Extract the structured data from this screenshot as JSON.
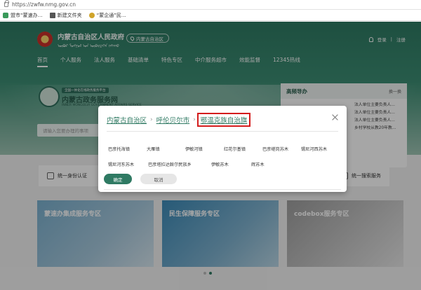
{
  "browser": {
    "url": "https://zwfw.nmg.gov.cn",
    "bookmarks": [
      "盟市“蒙速办…",
      "新建文件夹",
      "“蒙企通”民…"
    ]
  },
  "header": {
    "title": "内蒙古自治区人民政府",
    "subtitle": "ᠦᠪᠦᠷ ᠮᠣᠩᠭᠣᠯ ᠤᠨ ᠥᠪᠡᠷᠲᠡᠭᠡᠨ ᠵᠠᠰᠠᠬᠤ",
    "location": "内蒙古自治区",
    "login": "登录",
    "register": "注册",
    "nav": [
      "首页",
      "个人服务",
      "法人服务",
      "基础清单",
      "特色专区",
      "中介服务超市",
      "效能监督",
      "12345热线"
    ]
  },
  "platform": {
    "tag": "全国一体化在线政务服务平台",
    "name": "内蒙古政务服务网",
    "name_en": "INNER MONGOLIA GOVERNMENT AFFAIRS SERVICE",
    "search_placeholder": "请输入您要办理的事项"
  },
  "guide": {
    "title": "高频导办",
    "next": "换一换",
    "items": [
      "法人单位主要负责人…",
      "法人单位主要负责人…",
      "法人单位主要负责人…",
      "乡村学校从教20年教…"
    ]
  },
  "dialog": {
    "breadcrumb": [
      "内蒙古自治区",
      "呼伦贝尔市",
      "鄂温克族自治旗"
    ],
    "towns": [
      [
        "巴彦托海镇",
        "大雁镇",
        "伊敏河镇",
        "红花尔基镇",
        "巴彦嵯岗苏木",
        "锡尼河西苏木"
      ],
      [
        "锡尼河东苏木",
        "巴彦塔拉达斡尔民族乡",
        "伊敏苏木",
        "辉苏木"
      ]
    ],
    "confirm": "确定",
    "cancel": "取消"
  },
  "services": {
    "left": "统一身份认证",
    "right": "统一搜索服务"
  },
  "cards": [
    "蒙速办集成服务专区",
    "民生保障服务专区",
    "codebox服务专区"
  ]
}
